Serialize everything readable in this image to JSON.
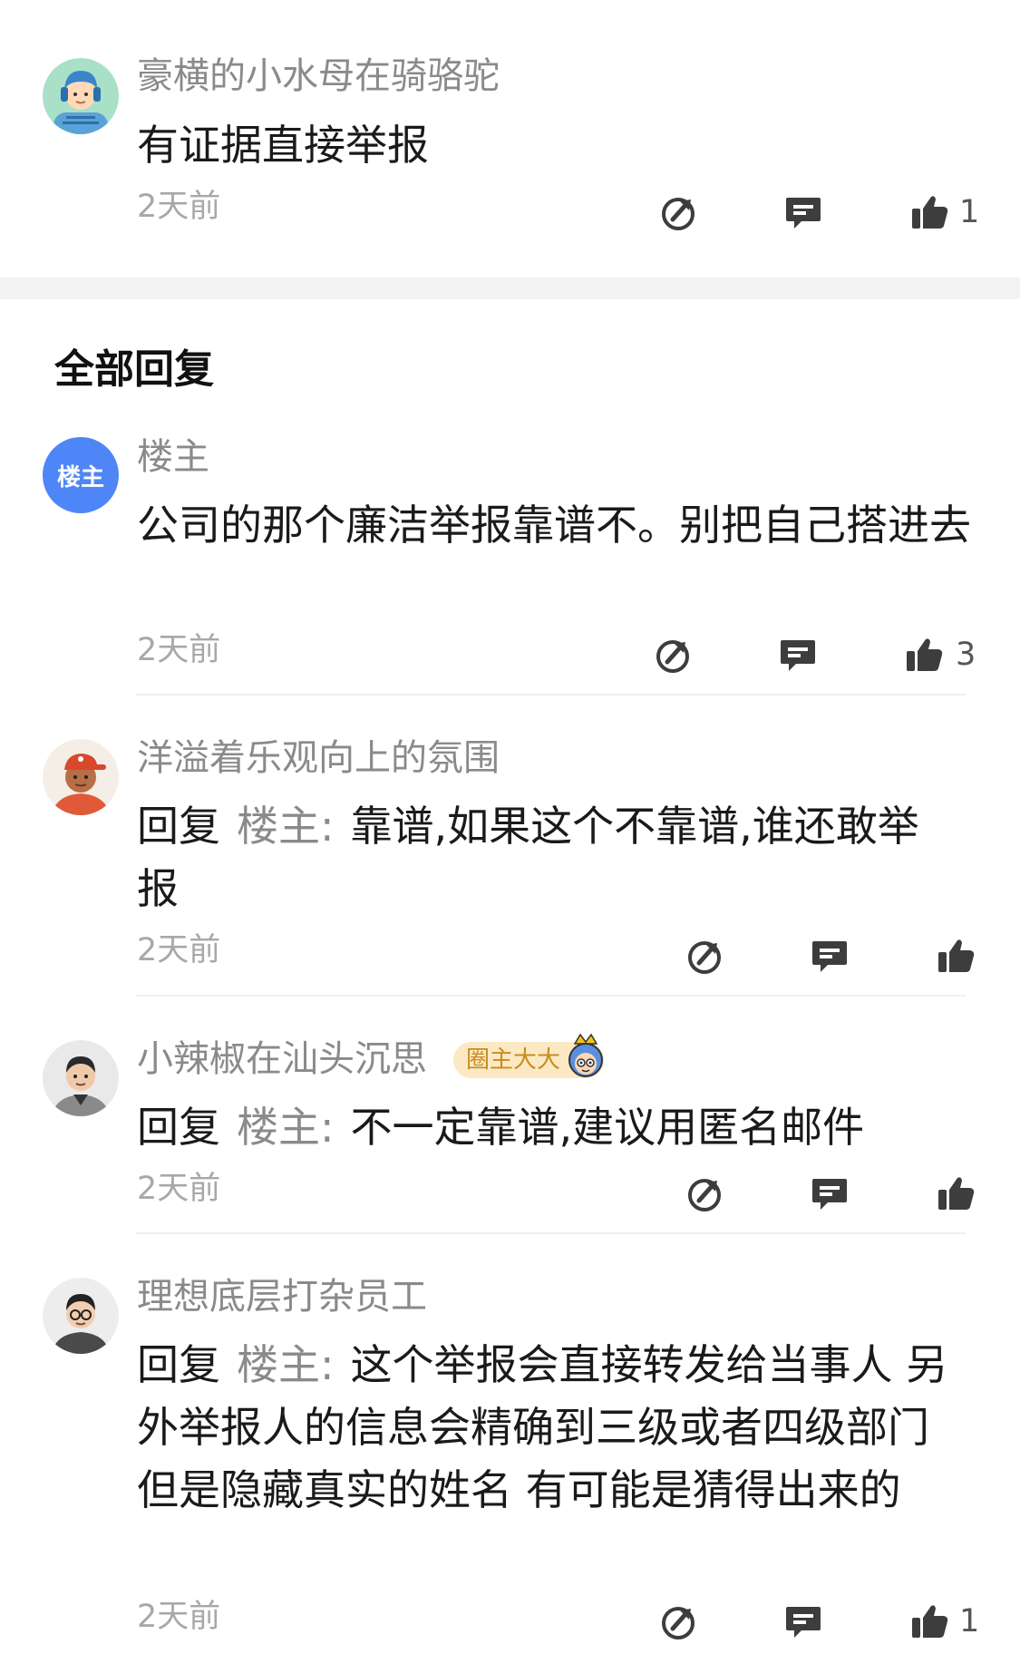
{
  "top_comment": {
    "author": "豪横的小水母在骑骆驼",
    "text": "有证据直接举报",
    "time": "2天前",
    "likes": "1"
  },
  "section": {
    "title": "全部回复"
  },
  "replies": [
    {
      "author": "楼主",
      "avatar_label": "楼主",
      "text": "公司的那个廉洁举报靠谱不。别把自己搭进去",
      "time": "2天前",
      "likes": "3"
    },
    {
      "author": "洋溢着乐观向上的氛围",
      "reply_prefix": "回复",
      "reply_target": "楼主",
      "reply_colon": ":",
      "text": "靠谱,如果这个不靠谱,谁还敢举报",
      "time": "2天前",
      "likes": ""
    },
    {
      "author": "小辣椒在汕头沉思",
      "badge": "圈主大大",
      "reply_prefix": "回复",
      "reply_target": "楼主",
      "reply_colon": ":",
      "text": "不一定靠谱,建议用匿名邮件",
      "time": "2天前",
      "likes": ""
    },
    {
      "author": "理想底层打杂员工",
      "reply_prefix": "回复",
      "reply_target": "楼主",
      "reply_colon": ":",
      "text": "这个举报会直接转发给当事人 另外举报人的信息会精确到三级或者四级部门 但是隐藏真实的姓名 有可能是猜得出来的",
      "time": "2天前",
      "likes": "1"
    }
  ],
  "icons": {
    "share": "share-icon",
    "comment": "comment-icon",
    "like": "thumbs-up-icon"
  },
  "colors": {
    "name_gray": "#8a8a8a",
    "text_dark": "#1a1a1a",
    "host_avatar_blue": "#4f86f7",
    "badge_bg": "#fbe9c4",
    "badge_text": "#c98b1e",
    "separator_band": "#f3f3f3"
  }
}
